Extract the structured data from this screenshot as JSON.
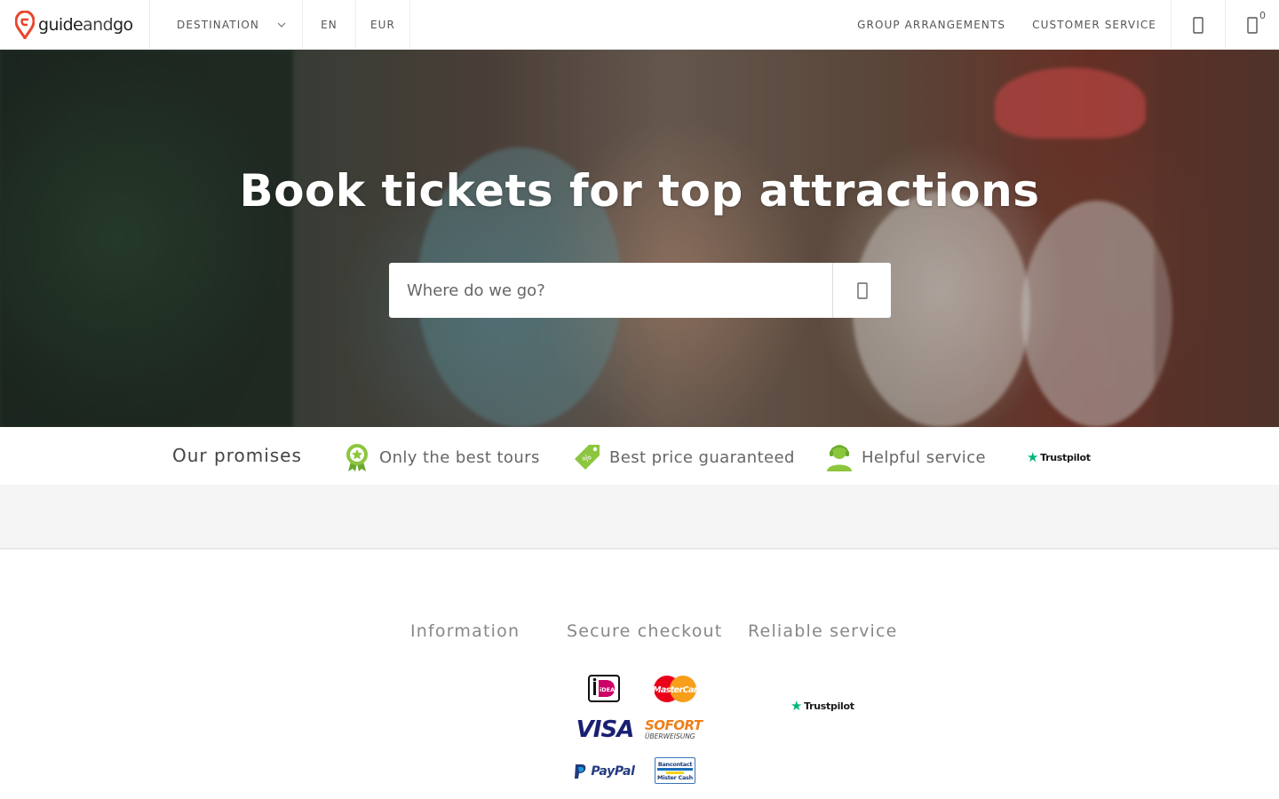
{
  "brand": {
    "name_part1": "guide",
    "name_part2": "and",
    "name_part3": "go",
    "accent": "#e8452c"
  },
  "header": {
    "destination_label": "DESTINATION",
    "language": "EN",
    "currency": "EUR",
    "group_link": "GROUP ARRANGEMENTS",
    "service_link": "CUSTOMER SERVICE",
    "account_icon": "user-icon",
    "cart_icon": "cart-icon",
    "cart_count": "0"
  },
  "hero": {
    "title": "Book tickets for top attractions",
    "search_placeholder": "Where do we go?",
    "search_icon": "search-icon"
  },
  "promises": {
    "title": "Our promises",
    "items": [
      {
        "label": "Only the best tours",
        "icon": "award-icon"
      },
      {
        "label": "Best price guaranteed",
        "icon": "price-tag-icon"
      },
      {
        "label": "Helpful service",
        "icon": "support-agent-icon"
      }
    ],
    "trustpilot": "Trustpilot"
  },
  "footer": {
    "columns": [
      "Information",
      "Secure checkout",
      "Reliable service"
    ],
    "payment_methods": [
      "iDEAL",
      "MasterCard",
      "VISA",
      "SOFORT",
      "ÜBERWEISUNG",
      "PayPal",
      "Bancontact",
      "Mister Cash"
    ],
    "trustpilot": "Trustpilot"
  },
  "colors": {
    "green": "#8cc63f",
    "trustpilot_green": "#00b67a",
    "grey_band": "#f5f5f5"
  }
}
